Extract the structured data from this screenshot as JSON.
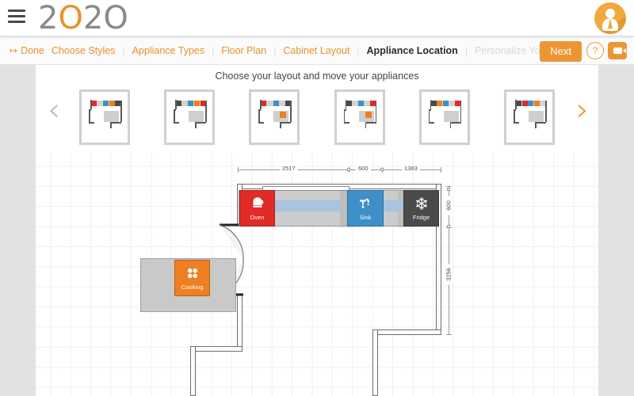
{
  "header": {
    "menu_icon": "hamburger-icon",
    "logo_text": "2020",
    "logo_parts": {
      "d1": "2",
      "o1": "O",
      "d2": "2",
      "o2": "O"
    },
    "avatar_icon": "user-avatar-icon"
  },
  "navbar": {
    "done_label": "Done",
    "done_icon": "exit-icon",
    "next_label": "Next",
    "help_label": "?",
    "video_icon": "video-camera-icon",
    "separator": "|",
    "steps": [
      {
        "label": "Choose Styles",
        "state": "link"
      },
      {
        "label": "Appliance Types",
        "state": "link"
      },
      {
        "label": "Floor Plan",
        "state": "link"
      },
      {
        "label": "Cabinet Layout",
        "state": "link"
      },
      {
        "label": "Appliance Location",
        "state": "active"
      },
      {
        "label": "Personalize Your Design",
        "state": "disabled"
      }
    ]
  },
  "carousel": {
    "title": "Choose your layout and move your appliances",
    "prev_icon": "chevron-left-icon",
    "next_icon": "chevron-right-icon",
    "thumbnails": [
      {
        "id": "layout-1",
        "selected": false
      },
      {
        "id": "layout-2",
        "selected": false
      },
      {
        "id": "layout-3",
        "selected": false
      },
      {
        "id": "layout-4",
        "selected": false
      },
      {
        "id": "layout-5",
        "selected": false
      },
      {
        "id": "layout-6",
        "selected": false
      }
    ]
  },
  "floorplan": {
    "dimensions_top": [
      {
        "value": "2517"
      },
      {
        "value": "600"
      },
      {
        "value": "1383"
      }
    ],
    "dimensions_right": [
      {
        "value": "600"
      },
      {
        "value": "3256"
      }
    ],
    "appliances": [
      {
        "name": "Oven",
        "icon": "oven-mitt-icon",
        "color": "#e02b26"
      },
      {
        "name": "Sink",
        "icon": "faucet-icon",
        "color": "#3d8fc7"
      },
      {
        "name": "Fridge",
        "icon": "snowflake-icon",
        "color": "#4a4a4a"
      },
      {
        "name": "Cooking",
        "icon": "burners-icon",
        "color": "#ee7f22"
      }
    ],
    "door_label": "double-door"
  },
  "colors": {
    "accent": "#ec9535",
    "logo_orange": "#e8922d",
    "panel_grey": "#e2e2e2",
    "counter_grey": "#cccccc",
    "grid_line": "#eef0f1"
  }
}
